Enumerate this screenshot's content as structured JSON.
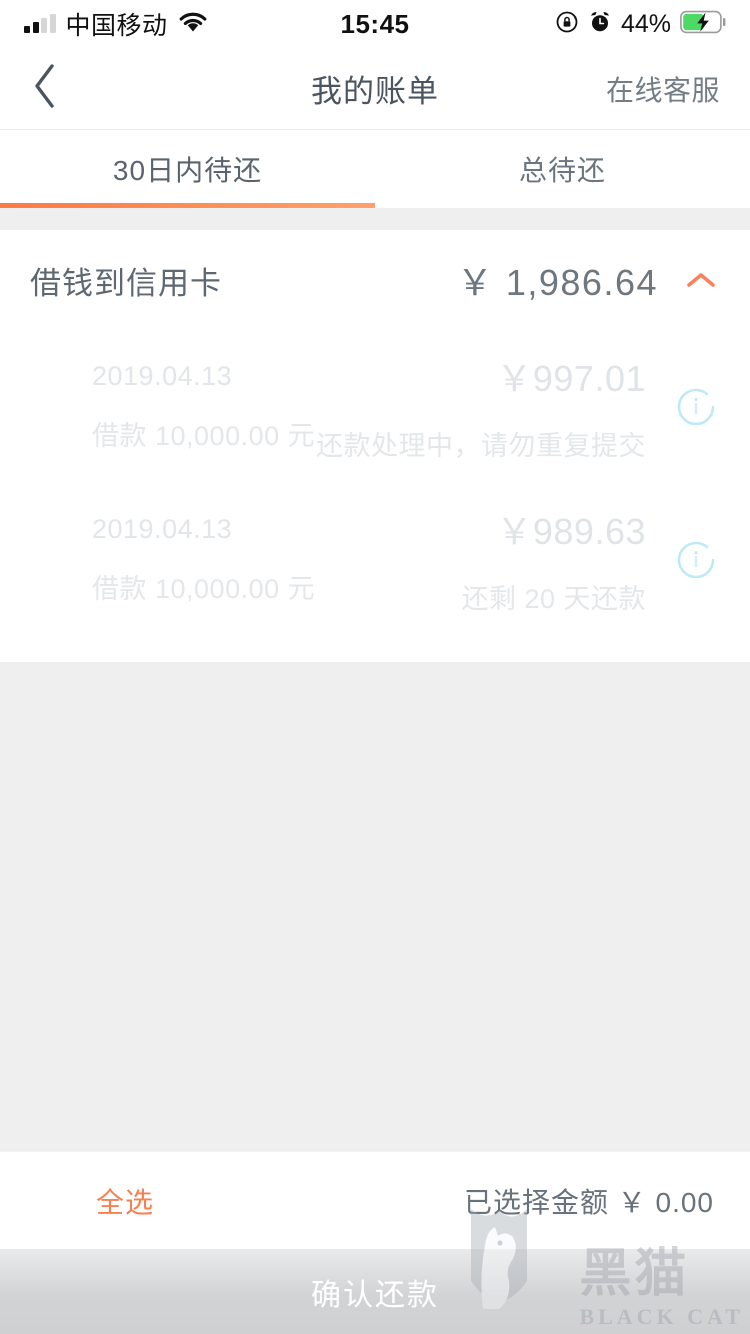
{
  "status_bar": {
    "carrier": "中国移动",
    "time": "15:45",
    "battery_percent": "44%",
    "icons": {
      "signal": "signal-bars-icon",
      "wifi": "wifi-icon",
      "rotation_lock": "rotation-lock-icon",
      "alarm": "alarm-clock-icon",
      "battery": "battery-charging-icon"
    }
  },
  "nav": {
    "back_icon": "chevron-left-icon",
    "title": "我的账单",
    "action_label": "在线客服"
  },
  "tabs": {
    "items": [
      {
        "label": "30日内待还",
        "active": true
      },
      {
        "label": "总待还",
        "active": false
      }
    ],
    "active_index": 0,
    "indicator_color": "#ff7a45"
  },
  "card": {
    "title": "借钱到信用卡",
    "amount": "￥ 1,986.64",
    "collapse_icon": "chevron-up-icon",
    "collapse_icon_color": "#f9815a",
    "expanded": true,
    "rows": [
      {
        "date": "2019.04.13",
        "amount": "￥997.01",
        "principal": "借款 10,000.00 元",
        "status": "还款处理中，请勿重复提交",
        "check_icon": "loading-circle-icon",
        "checked": false
      },
      {
        "date": "2019.04.13",
        "amount": "￥989.63",
        "principal": "借款 10,000.00 元",
        "status": "还剩 20 天还款",
        "check_icon": "loading-circle-icon",
        "checked": false
      }
    ]
  },
  "bottom_bar": {
    "select_all_label": "全选",
    "selected_amount_label": "已选择金额 ￥ 0.00",
    "confirm_label": "确认还款",
    "confirm_enabled": false
  },
  "watermark": {
    "cn": "黑猫",
    "en": "BLACK CAT",
    "shield_icon": "cat-shield-logo-icon"
  },
  "colors": {
    "accent_orange": "#ff7a45",
    "link_orange": "#f58150",
    "text_primary": "#5e6873",
    "text_secondary": "#737d87",
    "text_faded": "#e2e5e9",
    "page_bg": "#efefef",
    "card_bg": "#ffffff",
    "disabled_btn": "#d2d3d5"
  }
}
